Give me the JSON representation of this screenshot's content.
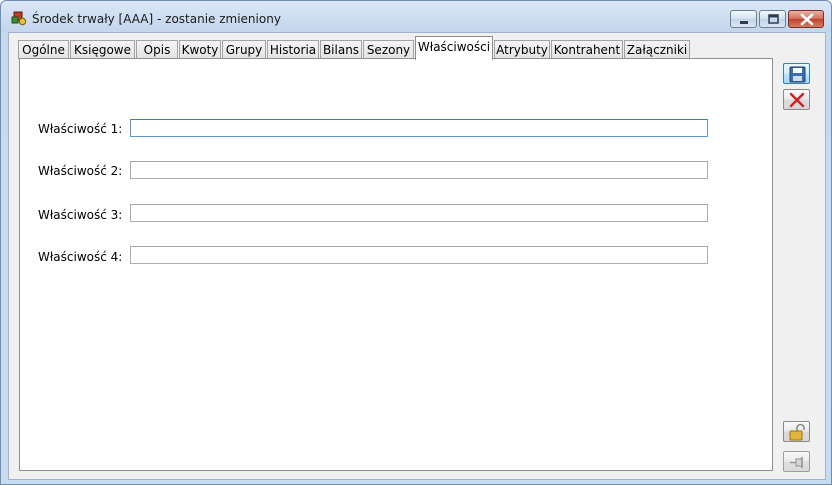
{
  "window": {
    "title": "Środek trwały [AAA] - zostanie zmieniony",
    "app_icon": "fixed-asset-app-icon",
    "controls": [
      "minimize-icon",
      "maximize-icon",
      "close-icon"
    ]
  },
  "tabs": [
    {
      "label": "Ogólne",
      "active": false
    },
    {
      "label": "Księgowe",
      "active": false
    },
    {
      "label": "Opis",
      "active": false
    },
    {
      "label": "Kwoty",
      "active": false
    },
    {
      "label": "Grupy",
      "active": false
    },
    {
      "label": "Historia",
      "active": false
    },
    {
      "label": "Bilans",
      "active": false
    },
    {
      "label": "Sezony",
      "active": false
    },
    {
      "label": "Właściwości",
      "active": true
    },
    {
      "label": "Atrybuty",
      "active": false
    },
    {
      "label": "Kontrahent",
      "active": false
    },
    {
      "label": "Załączniki",
      "active": false
    }
  ],
  "properties": [
    {
      "label": "Właściwość 1:",
      "value": "",
      "focused": true
    },
    {
      "label": "Właściwość 2:",
      "value": "",
      "focused": false
    },
    {
      "label": "Właściwość 3:",
      "value": "",
      "focused": false
    },
    {
      "label": "Właściwość 4:",
      "value": "",
      "focused": false
    }
  ],
  "side_buttons": {
    "save": "save-icon",
    "cancel": "cancel-icon",
    "lock": "unlock-icon",
    "pin": "pin-icon"
  },
  "colors": {
    "cancel_red": "#d21f1f",
    "save_blue": "#3a6fb5",
    "lock_gold": "#d9a72c"
  }
}
